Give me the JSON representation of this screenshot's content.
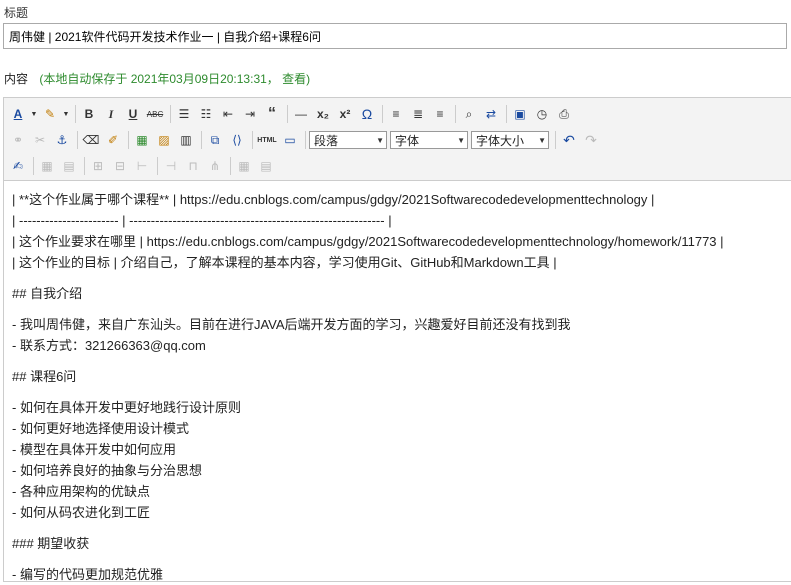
{
  "title_label": "标题",
  "title_value": "周伟健 | 2021软件代码开发技术作业一 | 自我介绍+课程6问",
  "content_label": "内容",
  "autosave_text": "(本地自动保存于 2021年03月09日20:13:31，",
  "view_link": "查看)",
  "toolbar": {
    "row1": [
      "font-color-icon",
      "highlight-icon",
      "bold-icon",
      "italic-icon",
      "underline-icon",
      "strikethrough-icon",
      "bullet-list-icon",
      "numbered-list-icon",
      "outdent-icon",
      "indent-icon",
      "blockquote-icon",
      "hr-icon",
      "subscript-icon",
      "superscript-icon",
      "omega-icon",
      "align-left-icon",
      "align-center-icon",
      "align-right-icon",
      "find-icon",
      "replace-icon",
      "paste-word-icon",
      "time-icon",
      "preview-icon"
    ],
    "format_select": "段落",
    "font_select": "字体",
    "size_select": "字体大小"
  },
  "body_lines": [
    "| **这个作业属于哪个课程** | https://edu.cnblogs.com/campus/gdgy/2021Softwarecodedevelopmenttechnology |",
    "| ----------------------- | ----------------------------------------------------------- |",
    "| 这个作业要求在哪里 | https://edu.cnblogs.com/campus/gdgy/2021Softwarecodedevelopmenttechnology/homework/11773 |",
    "| 这个作业的目标 | 介绍自己，了解本课程的基本内容，学习使用Git、GitHub和Markdown工具 |",
    "",
    "## 自我介绍",
    "",
    "- 我叫周伟健，来自广东汕头。目前在进行JAVA后端开发方面的学习，兴趣爱好目前还没有找到我",
    "- 联系方式：321266363@qq.com",
    "",
    "## 课程6问",
    "",
    "- 如何在具体开发中更好地践行设计原则",
    "- 如何更好地选择使用设计模式",
    "- 模型在具体开发中如何应用",
    "- 如何培养良好的抽象与分治思想",
    "- 各种应用架构的优缺点",
    "- 如何从码农进化到工匠",
    "",
    "### 期望收获",
    "",
    "- 编写的代码更加规范优雅"
  ]
}
